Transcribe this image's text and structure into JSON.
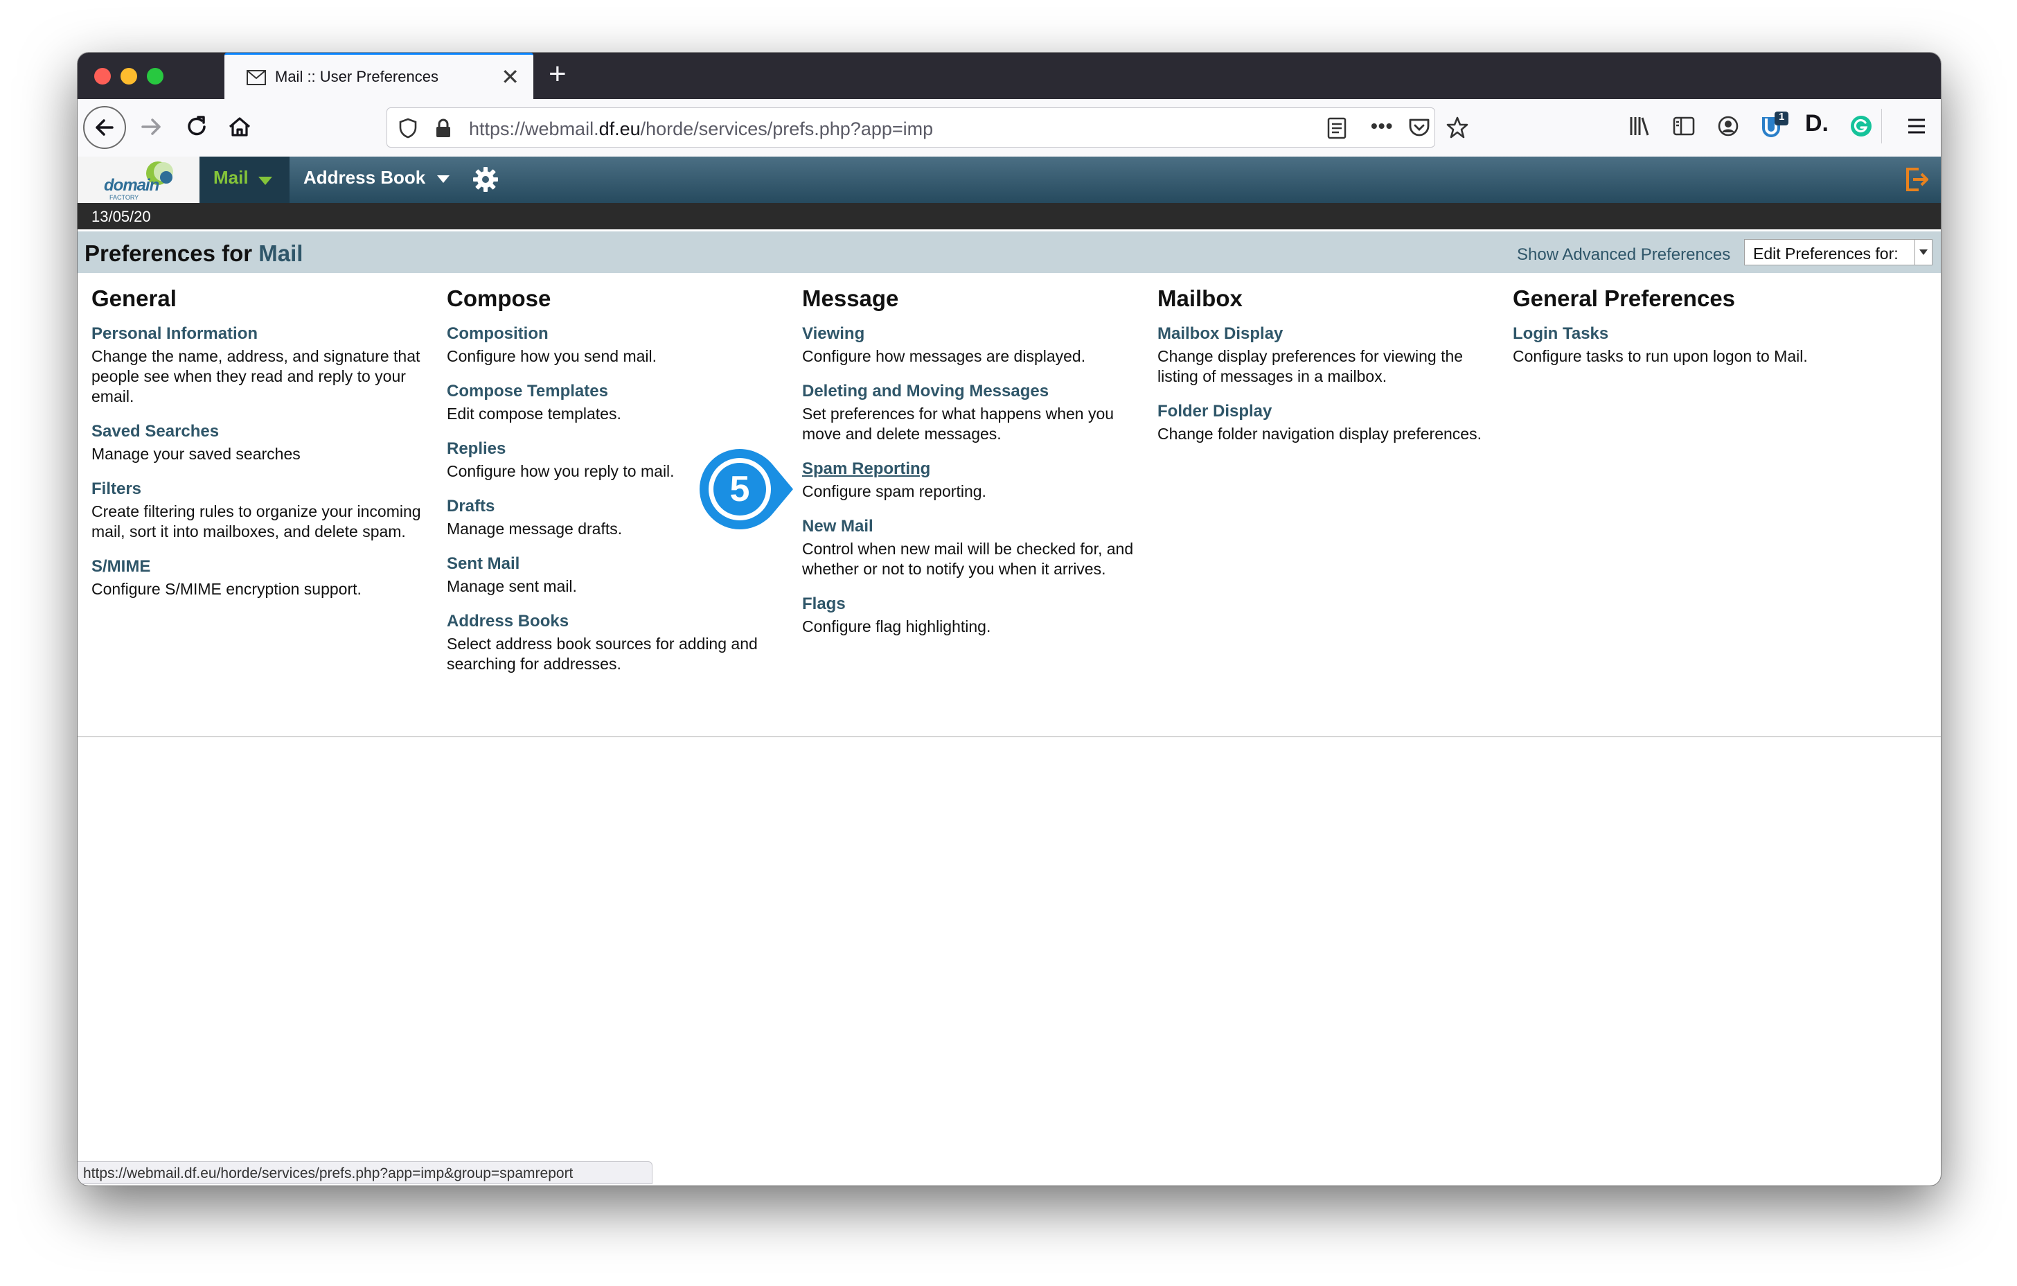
{
  "browser": {
    "tab_title": "Mail :: User Preferences",
    "url_prefix": "https://webmail.",
    "url_host": "df.eu",
    "url_path": "/horde/services/prefs.php?app=imp",
    "extension_badge": "1",
    "status_url": "https://webmail.df.eu/horde/services/prefs.php?app=imp&group=spamreport"
  },
  "header": {
    "logo_text": "domain",
    "logo_subtext": "FACTORY",
    "menu_mail": "Mail",
    "menu_address_book": "Address Book",
    "date": "13/05/20"
  },
  "prefs": {
    "title_prefix": "Preferences for",
    "title_app": "Mail",
    "show_advanced": "Show Advanced Preferences",
    "edit_for": "Edit Preferences for:"
  },
  "columns": [
    {
      "heading": "General",
      "items": [
        {
          "title": "Personal Information",
          "desc": "Change the name, address, and signature that people see when they read and reply to your email."
        },
        {
          "title": "Saved Searches",
          "desc": "Manage your saved searches"
        },
        {
          "title": "Filters",
          "desc": "Create filtering rules to organize your incoming mail, sort it into mailboxes, and delete spam."
        },
        {
          "title": "S/MIME",
          "desc": "Configure S/MIME encryption support."
        }
      ]
    },
    {
      "heading": "Compose",
      "items": [
        {
          "title": "Composition",
          "desc": "Configure how you send mail."
        },
        {
          "title": "Compose Templates",
          "desc": "Edit compose templates."
        },
        {
          "title": "Replies",
          "desc": "Configure how you reply to mail."
        },
        {
          "title": "Drafts",
          "desc": "Manage message drafts."
        },
        {
          "title": "Sent Mail",
          "desc": "Manage sent mail."
        },
        {
          "title": "Address Books",
          "desc": "Select address book sources for adding and searching for addresses."
        }
      ]
    },
    {
      "heading": "Message",
      "items": [
        {
          "title": "Viewing",
          "desc": "Configure how messages are displayed."
        },
        {
          "title": "Deleting and Moving Messages",
          "desc": "Set preferences for what happens when you move and delete messages."
        },
        {
          "title": "Spam Reporting",
          "desc": "Configure spam reporting."
        },
        {
          "title": "New Mail",
          "desc": "Control when new mail will be checked for, and whether or not to notify you when it arrives."
        },
        {
          "title": "Flags",
          "desc": "Configure flag highlighting."
        }
      ]
    },
    {
      "heading": "Mailbox",
      "items": [
        {
          "title": "Mailbox Display",
          "desc": "Change display preferences for viewing the listing of messages in a mailbox."
        },
        {
          "title": "Folder Display",
          "desc": "Change folder navigation display preferences."
        }
      ]
    },
    {
      "heading": "General Preferences",
      "items": [
        {
          "title": "Login Tasks",
          "desc": "Configure tasks to run upon logon to Mail."
        }
      ]
    }
  ],
  "callout_number": "5",
  "colors": {
    "accent_link": "#2f5669",
    "mail_menu_green": "#84c43a",
    "callout_blue": "#1a8fe3",
    "logout_orange": "#e8821e"
  }
}
